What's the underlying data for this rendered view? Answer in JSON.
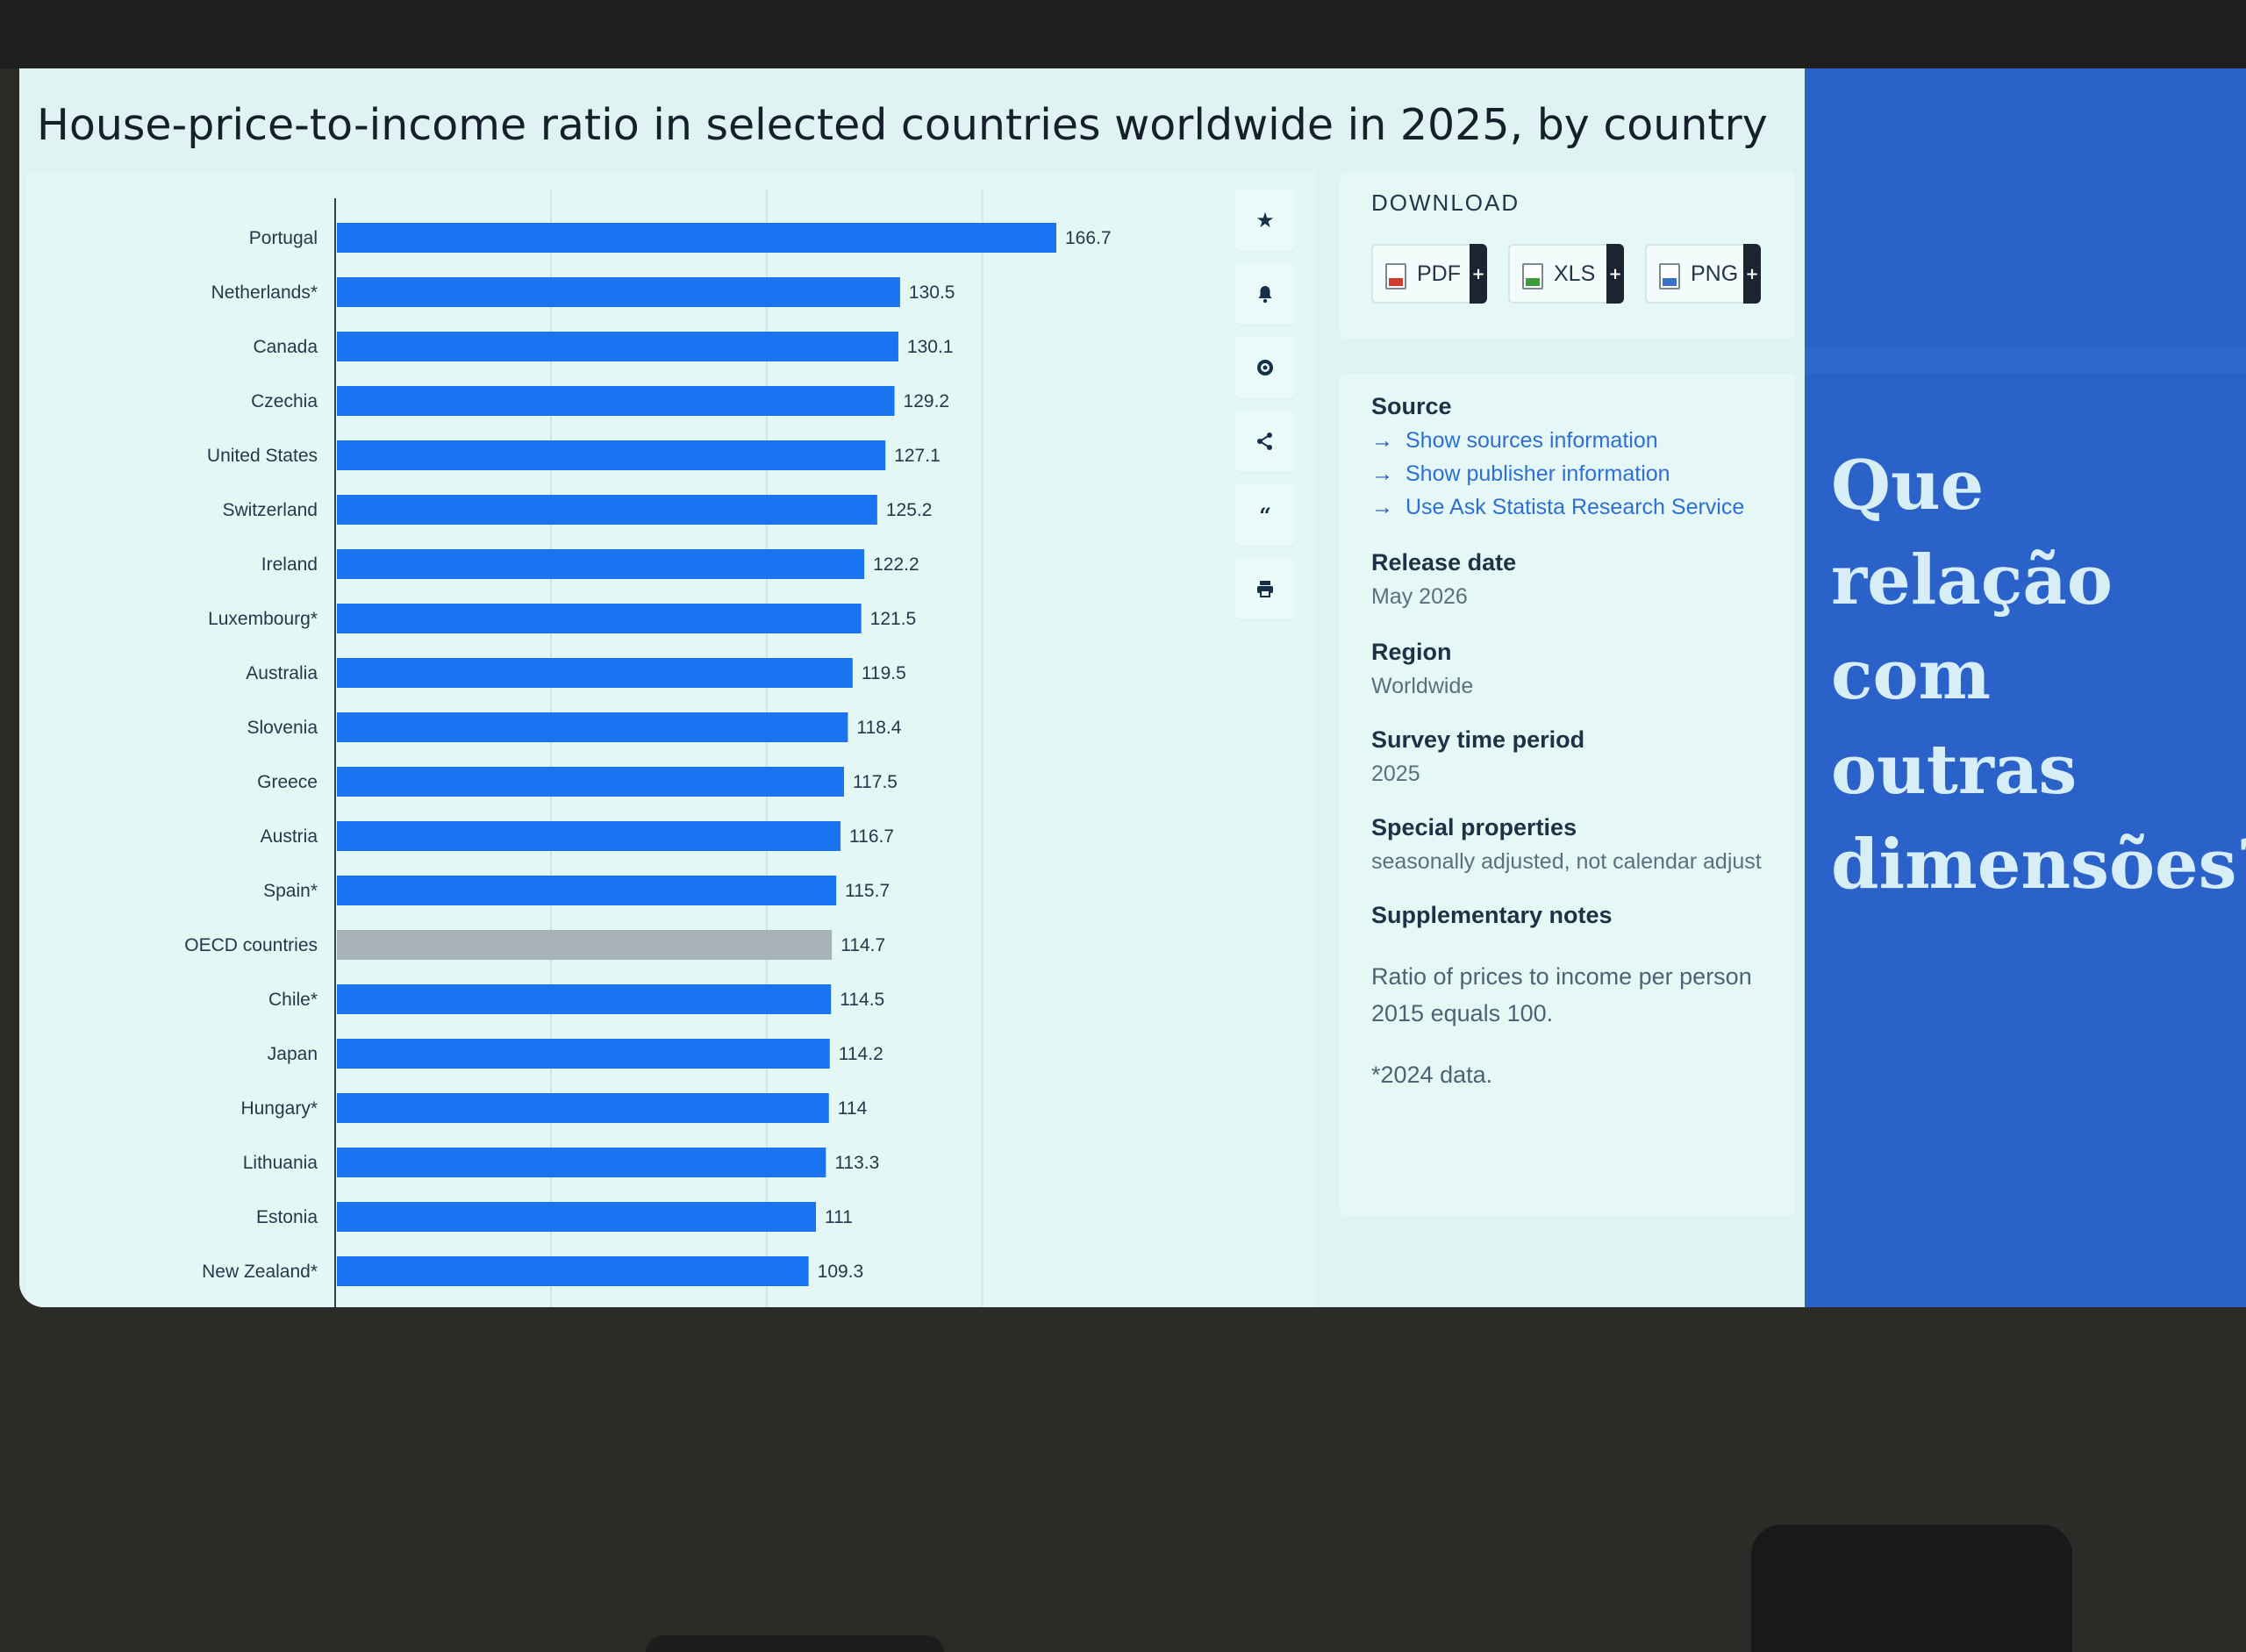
{
  "title": "House-price-to-income ratio in selected countries worldwide in 2025, by country",
  "toolbar": {
    "icons": [
      "star-icon",
      "bell-icon",
      "gear-icon",
      "share-icon",
      "quote-icon",
      "print-icon"
    ]
  },
  "download": {
    "title": "DOWNLOAD",
    "buttons": [
      {
        "label": "PDF",
        "color": "#d23c2c"
      },
      {
        "label": "XLS",
        "color": "#3e9a3a"
      },
      {
        "label": "PNG",
        "color": "#3a72c4"
      }
    ]
  },
  "info": {
    "source_heading": "Source",
    "source_links": [
      "Show sources information",
      "Show publisher information",
      "Use Ask Statista Research Service"
    ],
    "release_heading": "Release date",
    "release_value": "May 2026",
    "region_heading": "Region",
    "region_value": "Worldwide",
    "survey_heading": "Survey time period",
    "survey_value": "2025",
    "special_heading": "Special properties",
    "special_value": "seasonally adjusted, not calendar adjust",
    "notes_heading": "Supplementary notes",
    "notes_line1": "Ratio of prices to income per person",
    "notes_line2": "2015 equals 100.",
    "notes_line3": "*2024 data."
  },
  "side_question": "Que relação com outras dimensões?",
  "colors": {
    "bar": "#1a74f2",
    "bar_highlight": "#a7b3b8",
    "blue_panel": "#2b62c9"
  },
  "chart_data": {
    "type": "bar",
    "orientation": "horizontal",
    "title": "House-price-to-income ratio in selected countries worldwide in 2025, by country",
    "categories": [
      "Portugal",
      "Netherlands*",
      "Canada",
      "Czechia",
      "United States",
      "Switzerland",
      "Ireland",
      "Luxembourg*",
      "Australia",
      "Slovenia",
      "Greece",
      "Austria",
      "Spain*",
      "OECD countries",
      "Chile*",
      "Japan",
      "Hungary*",
      "Lithuania",
      "Estonia",
      "New Zealand*"
    ],
    "values": [
      166.7,
      130.5,
      130.1,
      129.2,
      127.1,
      125.2,
      122.2,
      121.5,
      119.5,
      118.4,
      117.5,
      116.7,
      115.7,
      114.7,
      114.5,
      114.2,
      114,
      113.3,
      111,
      109.3
    ],
    "value_labels": [
      "166.7",
      "130.5",
      "130.1",
      "129.2",
      "127.1",
      "125.2",
      "122.2",
      "121.5",
      "119.5",
      "118.4",
      "117.5",
      "116.7",
      "115.7",
      "114.7",
      "114.5",
      "114.2",
      "114",
      "113.3",
      "111",
      "109.3"
    ],
    "highlight_category": "OECD countries",
    "xlim": [
      0,
      200
    ],
    "grid": true,
    "xlabel": "",
    "ylabel": ""
  }
}
